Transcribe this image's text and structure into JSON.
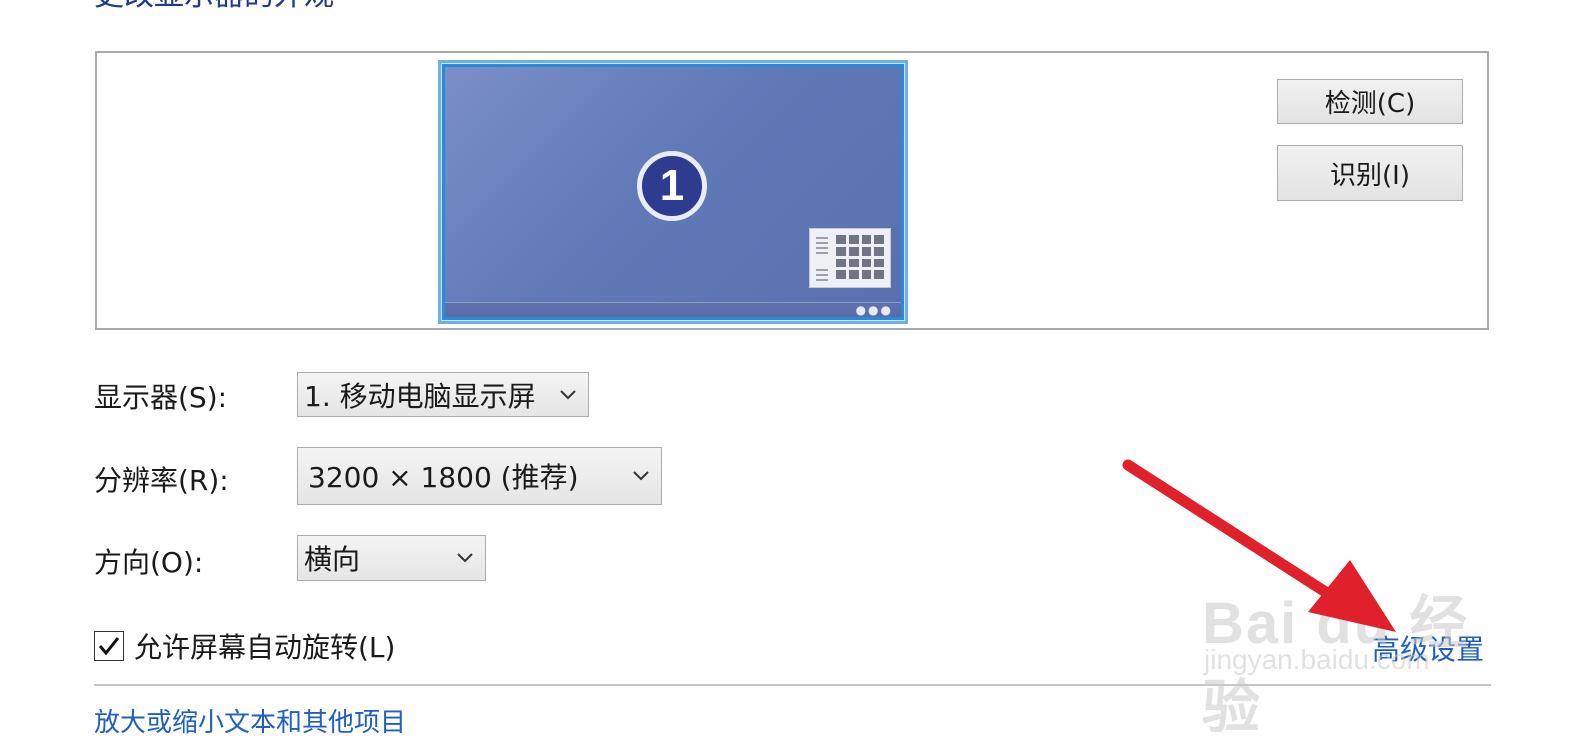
{
  "page_title": "更改显示器的外观",
  "preview": {
    "monitor_number": "1"
  },
  "buttons": {
    "detect": "检测(C)",
    "identify": "识别(I)"
  },
  "display": {
    "label": "显示器(S):",
    "value": "1. 移动电脑显示屏"
  },
  "resolution": {
    "label": "分辨率(R):",
    "value": "3200 × 1800 (推荐)"
  },
  "orientation": {
    "label": "方向(O):",
    "value": "横向"
  },
  "auto_rotate": {
    "label": "允许屏幕自动旋转(L)",
    "checked": true
  },
  "advanced_link": "高级设置",
  "next_link": "放大或缩小文本和其他项目",
  "watermark": {
    "main": "Bai du 经验",
    "sub": "jingyan.baidu.com"
  },
  "colors": {
    "link": "#1f5fbf",
    "arrow": "#e0202a",
    "monitor_bg": "#6279b8"
  },
  "icons": {
    "chevron": "chevron-down-icon",
    "check": "checkmark-icon"
  }
}
